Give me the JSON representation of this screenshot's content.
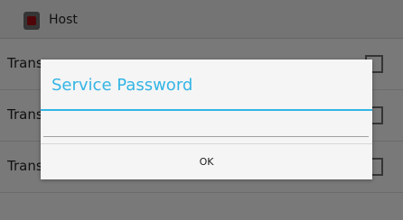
{
  "app_bar": {
    "title": "Host",
    "icon": "app-icon"
  },
  "rows": [
    {
      "label": "Trans",
      "checked": false
    },
    {
      "label": "Trans",
      "checked": false
    },
    {
      "label": "Trans",
      "checked": false
    }
  ],
  "dialog": {
    "title": "Service Password",
    "password_value": "",
    "ok_label": "OK"
  },
  "colors": {
    "accent": "#33b5e5",
    "icon": "#a00d12"
  }
}
